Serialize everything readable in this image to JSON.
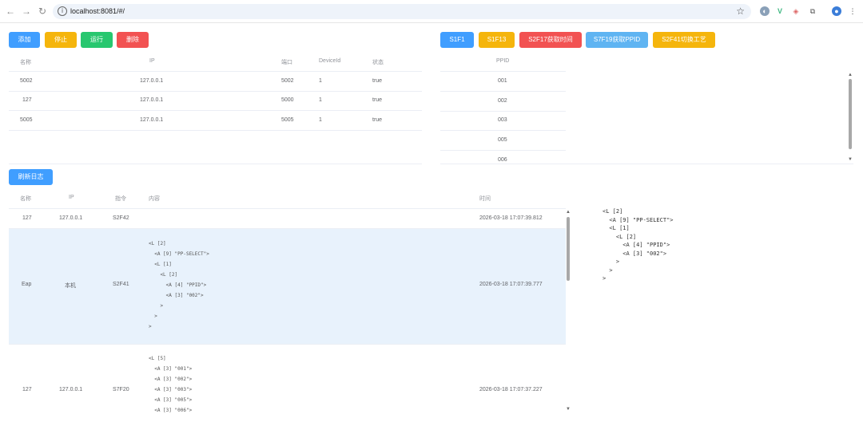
{
  "browser": {
    "url": "localhost:8081/#/"
  },
  "toolbar_left": {
    "add": "添加",
    "stop": "停止",
    "run": "运行",
    "delete": "删除"
  },
  "toolbar_right": {
    "s1f1": "S1F1",
    "s1f13": "S1F13",
    "s2f17": "S2F17获取时间",
    "s7f19": "S7F19获取PPID",
    "s2f41": "S2F41切换工艺"
  },
  "device_table": {
    "headers": [
      "名称",
      "IP",
      "端口",
      "DeviceId",
      "状态"
    ],
    "rows": [
      [
        "5002",
        "127.0.0.1",
        "5002",
        "1",
        "true"
      ],
      [
        "127",
        "127.0.0.1",
        "5000",
        "1",
        "true"
      ],
      [
        "5005",
        "127.0.0.1",
        "5005",
        "1",
        "true"
      ]
    ]
  },
  "ppid_table": {
    "header": "PPID",
    "rows": [
      "001",
      "002",
      "003",
      "005",
      "006"
    ]
  },
  "log": {
    "refresh": "刷新日志",
    "headers": [
      "名称",
      "IP",
      "指令",
      "内容",
      "时间"
    ],
    "rows": [
      {
        "name": "127",
        "ip": "127.0.0.1",
        "cmd": "S2F42",
        "content": "",
        "time": "2026-03-18 17:07:39.812"
      },
      {
        "name": "Eap",
        "ip": "本机",
        "cmd": "S2F41",
        "content": "<L [2]\n  <A [9] \"PP-SELECT\">\n  <L [1]\n    <L [2]\n      <A [4] \"PPID\">\n      <A [3] \"002\">\n    >\n  >\n>",
        "time": "2026-03-18 17:07:39.777"
      },
      {
        "name": "127",
        "ip": "127.0.0.1",
        "cmd": "S7F20",
        "content": "<L [5]\n  <A [3] \"001\">\n  <A [3] \"002\">\n  <A [3] \"003\">\n  <A [3] \"005\">\n  <A [3] \"006\">",
        "time": "2026-03-18 17:07:37.227"
      }
    ]
  },
  "detail": {
    "content": "<L [2]\n  <A [9] \"PP-SELECT\">\n  <L [1]\n    <L [2]\n      <A [4] \"PPID\">\n      <A [3] \"002\">\n    >\n  >\n>"
  },
  "colors": {
    "blue": "#409eff",
    "yellow": "#f5b50c",
    "green": "#28c76f",
    "red": "#f25252",
    "light_blue": "#5fb4f2",
    "selected_row": "#e8f2fc"
  }
}
